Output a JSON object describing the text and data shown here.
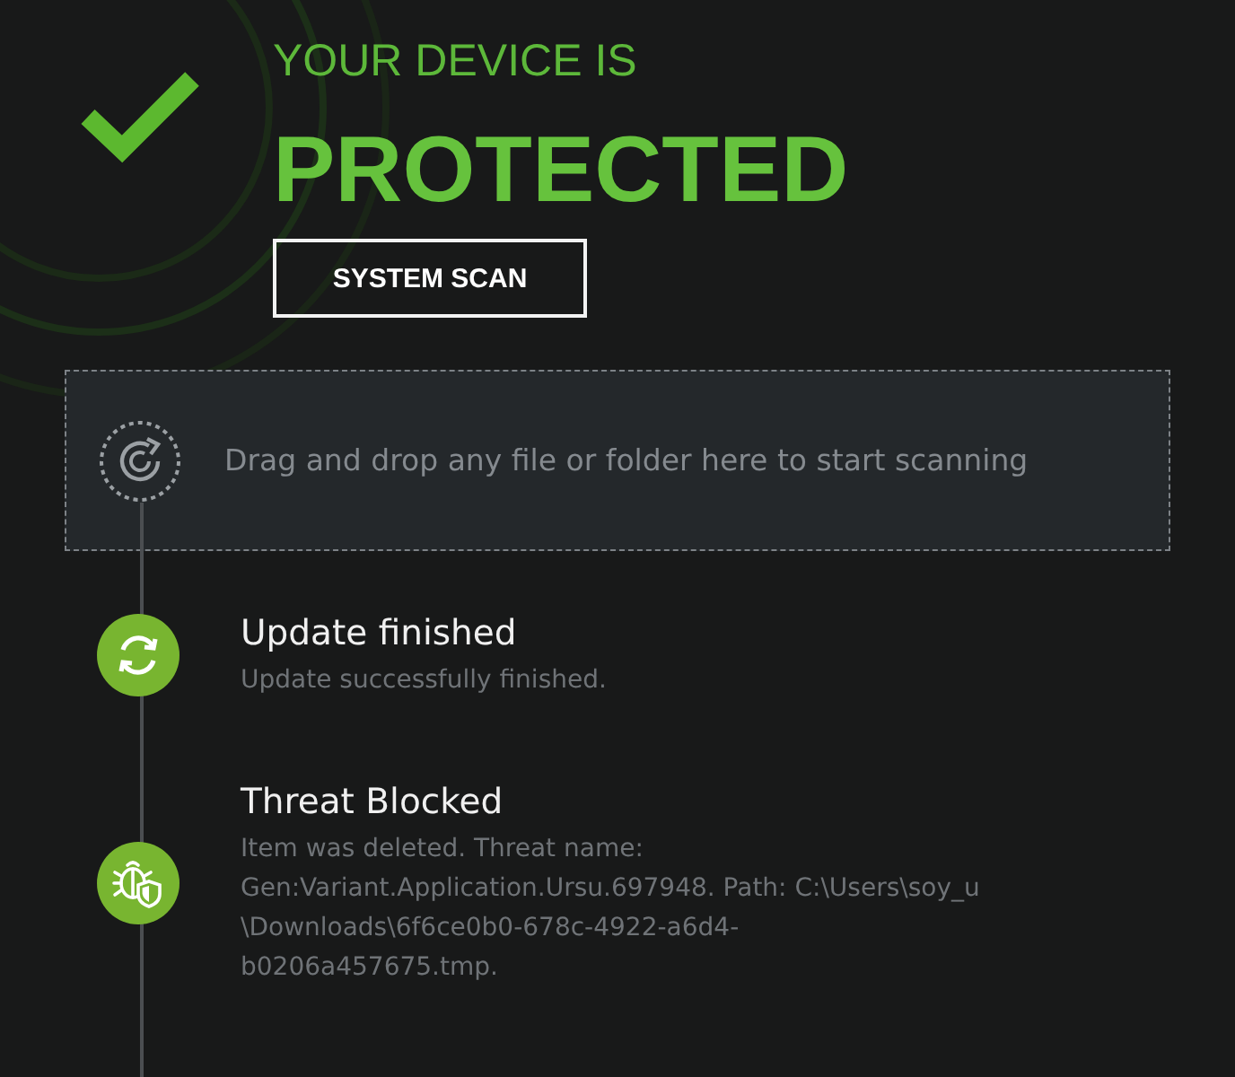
{
  "status": {
    "heading": "YOUR DEVICE IS",
    "state": "PROTECTED"
  },
  "scan_button": {
    "label": "SYSTEM SCAN"
  },
  "drop_zone": {
    "text": "Drag and drop any file or folder here to start scanning"
  },
  "events": [
    {
      "kind": "update",
      "title": "Update finished",
      "description": "Update successfully finished."
    },
    {
      "kind": "threat",
      "title": "Threat Blocked",
      "description": "Item was deleted. Threat name: Gen:Variant.Application.Ursu.697948. Path: C:\\Users\\soy_u\\Downloads\\6f6ce0b0-678c-4922-a6d4-b0206a457675.tmp."
    }
  ]
}
